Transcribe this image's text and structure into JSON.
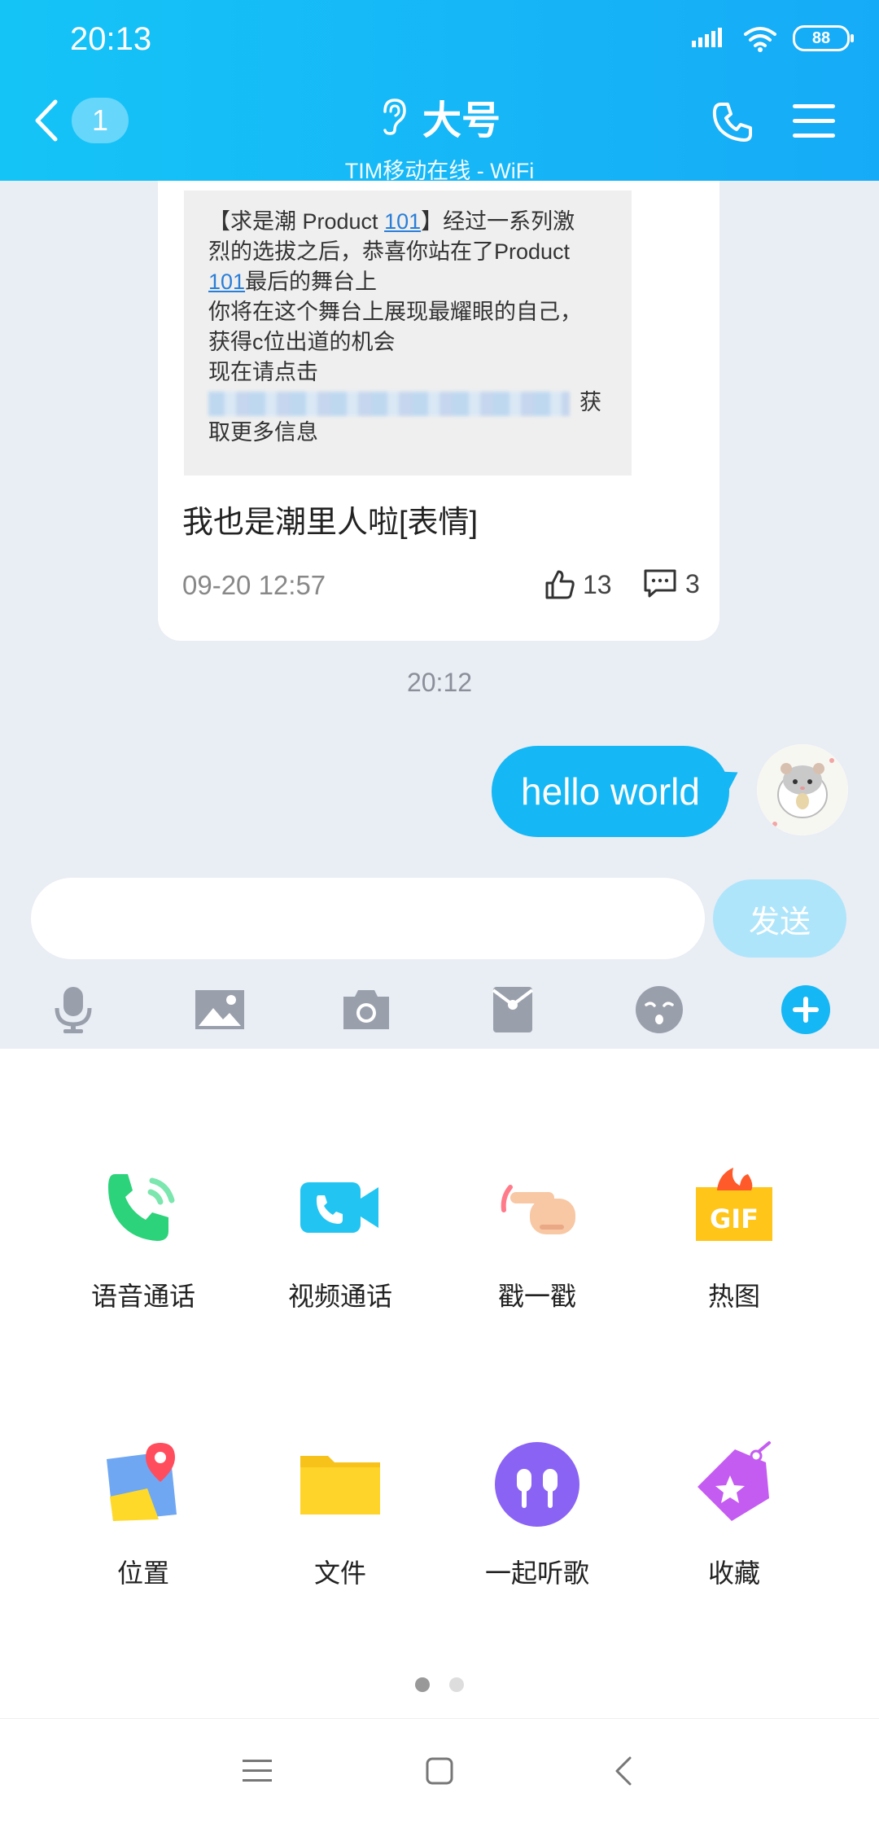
{
  "status_bar": {
    "time": "20:13",
    "battery": "88"
  },
  "header": {
    "back_badge": "1",
    "title": "大号",
    "subtitle": "TIM移动在线 - WiFi"
  },
  "card": {
    "quote_lines": {
      "l1a": "【求是潮 Product ",
      "l1link": "101",
      "l1b": "】经过一系列激",
      "l2": "烈的选拔之后，恭喜你站在了Product",
      "l3link": "101",
      "l3b": "最后的舞台上",
      "l4": "你将在这个舞台上展现最耀眼的自己，",
      "l5": "获得c位出道的机会",
      "l6": "现在请点击",
      "l7tail": "获",
      "l8": "取更多信息"
    },
    "text": "我也是潮里人啦[表情]",
    "date": "09-20 12:57",
    "likes": "13",
    "comments": "3"
  },
  "chat": {
    "time_separator": "20:12",
    "message": "hello world"
  },
  "input": {
    "value": "",
    "send_label": "发送"
  },
  "toolbar": [
    "microphone-icon",
    "image-icon",
    "camera-icon",
    "red-packet-icon",
    "emoji-icon",
    "plus-icon"
  ],
  "features": [
    {
      "label": "语音通话",
      "icon": "voice-call-icon"
    },
    {
      "label": "视频通话",
      "icon": "video-call-icon"
    },
    {
      "label": "戳一戳",
      "icon": "poke-icon"
    },
    {
      "label": "热图",
      "icon": "hot-gif-icon"
    },
    {
      "label": "位置",
      "icon": "location-icon"
    },
    {
      "label": "文件",
      "icon": "file-icon"
    },
    {
      "label": "一起听歌",
      "icon": "listen-together-icon"
    },
    {
      "label": "收藏",
      "icon": "favorites-icon"
    }
  ],
  "pager": {
    "current": 1,
    "total": 2
  },
  "colors": {
    "accent": "#15b7f5",
    "header": "#16abf7",
    "chat_bg": "#e9edf4"
  }
}
